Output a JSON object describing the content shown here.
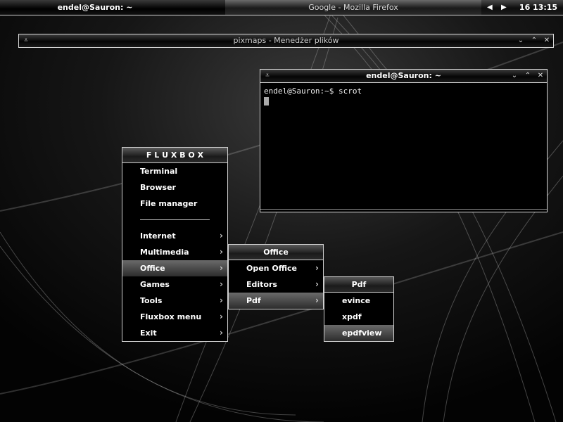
{
  "toolbar": {
    "workspace": "endel@Sauron: ~",
    "task": "Google - Mozilla Firefox",
    "clock": "16 13:15"
  },
  "filemanager": {
    "title": "pixmaps - Menedżer plików"
  },
  "terminal": {
    "title": "endel@Sauron: ~",
    "prompt_line": "endel@Sauron:~$ scrot"
  },
  "root_menu": {
    "title": "F L U X B O X",
    "items": [
      "Terminal",
      "Browser",
      "File manager",
      "Internet",
      "Multimedia",
      "Office",
      "Games",
      "Tools",
      "Fluxbox menu",
      "Exit"
    ]
  },
  "office_menu": {
    "title": "Office",
    "items": [
      "Open Office",
      "Editors",
      "Pdf"
    ]
  },
  "pdf_menu": {
    "title": "Pdf",
    "items": [
      "evince",
      "xpdf",
      "epdfview"
    ]
  },
  "icons": {
    "shade": "shade-icon",
    "minimize": "minimize-icon",
    "maximize": "maximize-icon",
    "close": "close-icon",
    "submenu": "chevron-right-icon"
  }
}
